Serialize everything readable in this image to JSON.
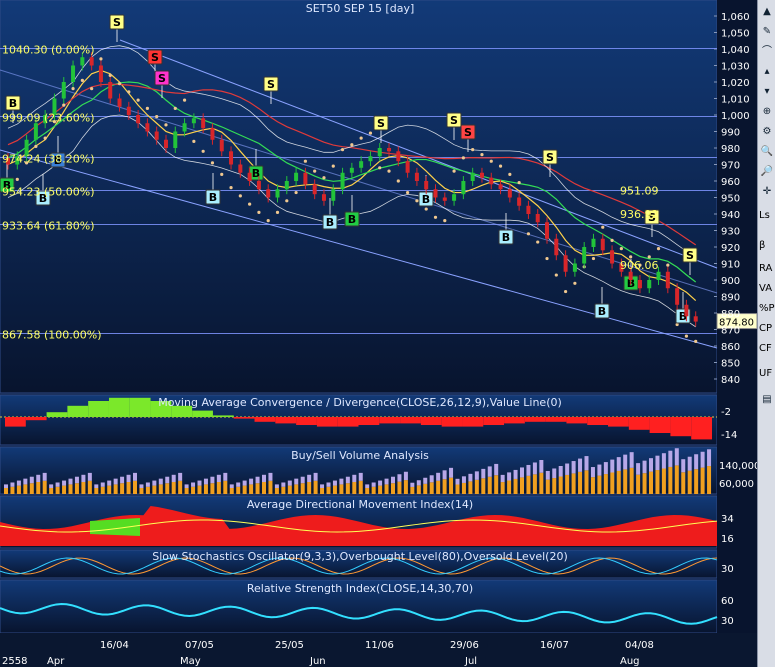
{
  "chart_data": [
    {
      "type": "candlestick",
      "title": "SET50 SEP 15",
      "interval": "[day]",
      "ylim": [
        830,
        1065
      ],
      "y_ticks": [
        "1,060",
        "1,050",
        "1,040",
        "1,030",
        "1,020",
        "1,010",
        "1,000",
        "990",
        "980",
        "970",
        "960",
        "950",
        "940",
        "930",
        "920",
        "910",
        "900",
        "890",
        "880",
        "870",
        "860",
        "850",
        "840"
      ],
      "last_value": "874.80",
      "fibonacci": [
        {
          "label": "1040.30 (0.00%)",
          "value": 1040.3
        },
        {
          "label": "999.09 (23.60%)",
          "value": 999.09
        },
        {
          "label": "974.24 (38.20%)",
          "value": 974.24
        },
        {
          "label": "954.23 (50.00%)",
          "value": 954.23
        },
        {
          "label": "933.64 (61.80%)",
          "value": 933.64
        },
        {
          "label": "867.58 (100.00%)",
          "value": 867.58
        }
      ],
      "price_annotations": [
        {
          "label": "951.09",
          "value": 951.09
        },
        {
          "label": "936.92",
          "value": 936.92
        },
        {
          "label": "906.06",
          "value": 906.06
        }
      ],
      "signals": [
        "S",
        "S",
        "S",
        "S",
        "S",
        "S",
        "S",
        "S",
        "S",
        "S",
        "B",
        "B",
        "B",
        "B",
        "B",
        "B",
        "B",
        "B",
        "B",
        "B",
        "B",
        "B",
        "B"
      ],
      "close_series_approx": [
        970,
        975,
        985,
        995,
        1000,
        1010,
        1020,
        1030,
        1035,
        1030,
        1020,
        1010,
        1005,
        1000,
        995,
        990,
        985,
        980,
        990,
        995,
        998,
        992,
        985,
        978,
        970,
        965,
        960,
        955,
        950,
        955,
        960,
        965,
        958,
        952,
        948,
        955,
        965,
        968,
        972,
        975,
        980,
        978,
        972,
        965,
        960,
        955,
        950,
        948,
        952,
        960,
        965,
        962,
        958,
        955,
        950,
        945,
        940,
        935,
        925,
        915,
        905,
        910,
        920,
        925,
        918,
        910,
        905,
        900,
        895,
        900,
        905,
        895,
        885,
        878,
        874.8
      ]
    },
    {
      "type": "line",
      "title": "Moving Average Convergence / Divergence(CLOSE,26,12,9),Value Line(0)",
      "y_ticks": [
        "-2",
        "-14"
      ],
      "macd_approx": [
        -6,
        -2,
        3,
        7,
        10,
        12,
        12,
        10,
        7,
        4,
        1,
        -1,
        -3,
        -4,
        -5,
        -6,
        -6,
        -5,
        -4,
        -4,
        -5,
        -6,
        -6,
        -5,
        -4,
        -3,
        -3,
        -4,
        -5,
        -6,
        -8,
        -10,
        -12,
        -14
      ]
    },
    {
      "type": "bar",
      "title": "Buy/Sell Volume Analysis",
      "y_ticks": [
        "140,000",
        "60,000"
      ]
    },
    {
      "type": "area",
      "title": "Average Directional Movement Index(14)",
      "y_ticks": [
        "34",
        "16"
      ]
    },
    {
      "type": "line",
      "title": "Slow Stochastics Oscillator(9,3,3),Overbought Level(80),Oversold Level(20)",
      "y_ticks": [
        "30"
      ]
    },
    {
      "type": "line",
      "title": "Relative Strength Index(CLOSE,14,30,70)",
      "y_ticks": [
        "60",
        "30"
      ]
    }
  ],
  "x_axis": {
    "labels": [
      "2558",
      "Apr",
      "16/04",
      "May",
      "07/05",
      "25/05",
      "Jun",
      "11/06",
      "29/06",
      "Jul",
      "16/07",
      "Aug",
      "04/08"
    ]
  },
  "toolbar": {
    "texts": [
      "Ls",
      "β",
      "RA",
      "VA",
      "%P",
      "CP",
      "CF",
      "UF"
    ]
  },
  "colors": {
    "background": "#0a1b3a",
    "panel_top": "#0d2552",
    "up": "#22c33a",
    "down": "#d8262a",
    "fib": "#ffff66",
    "sell": "#ffff88",
    "buy_green": "#22cc44",
    "buy_cyan": "#aaeeff"
  }
}
